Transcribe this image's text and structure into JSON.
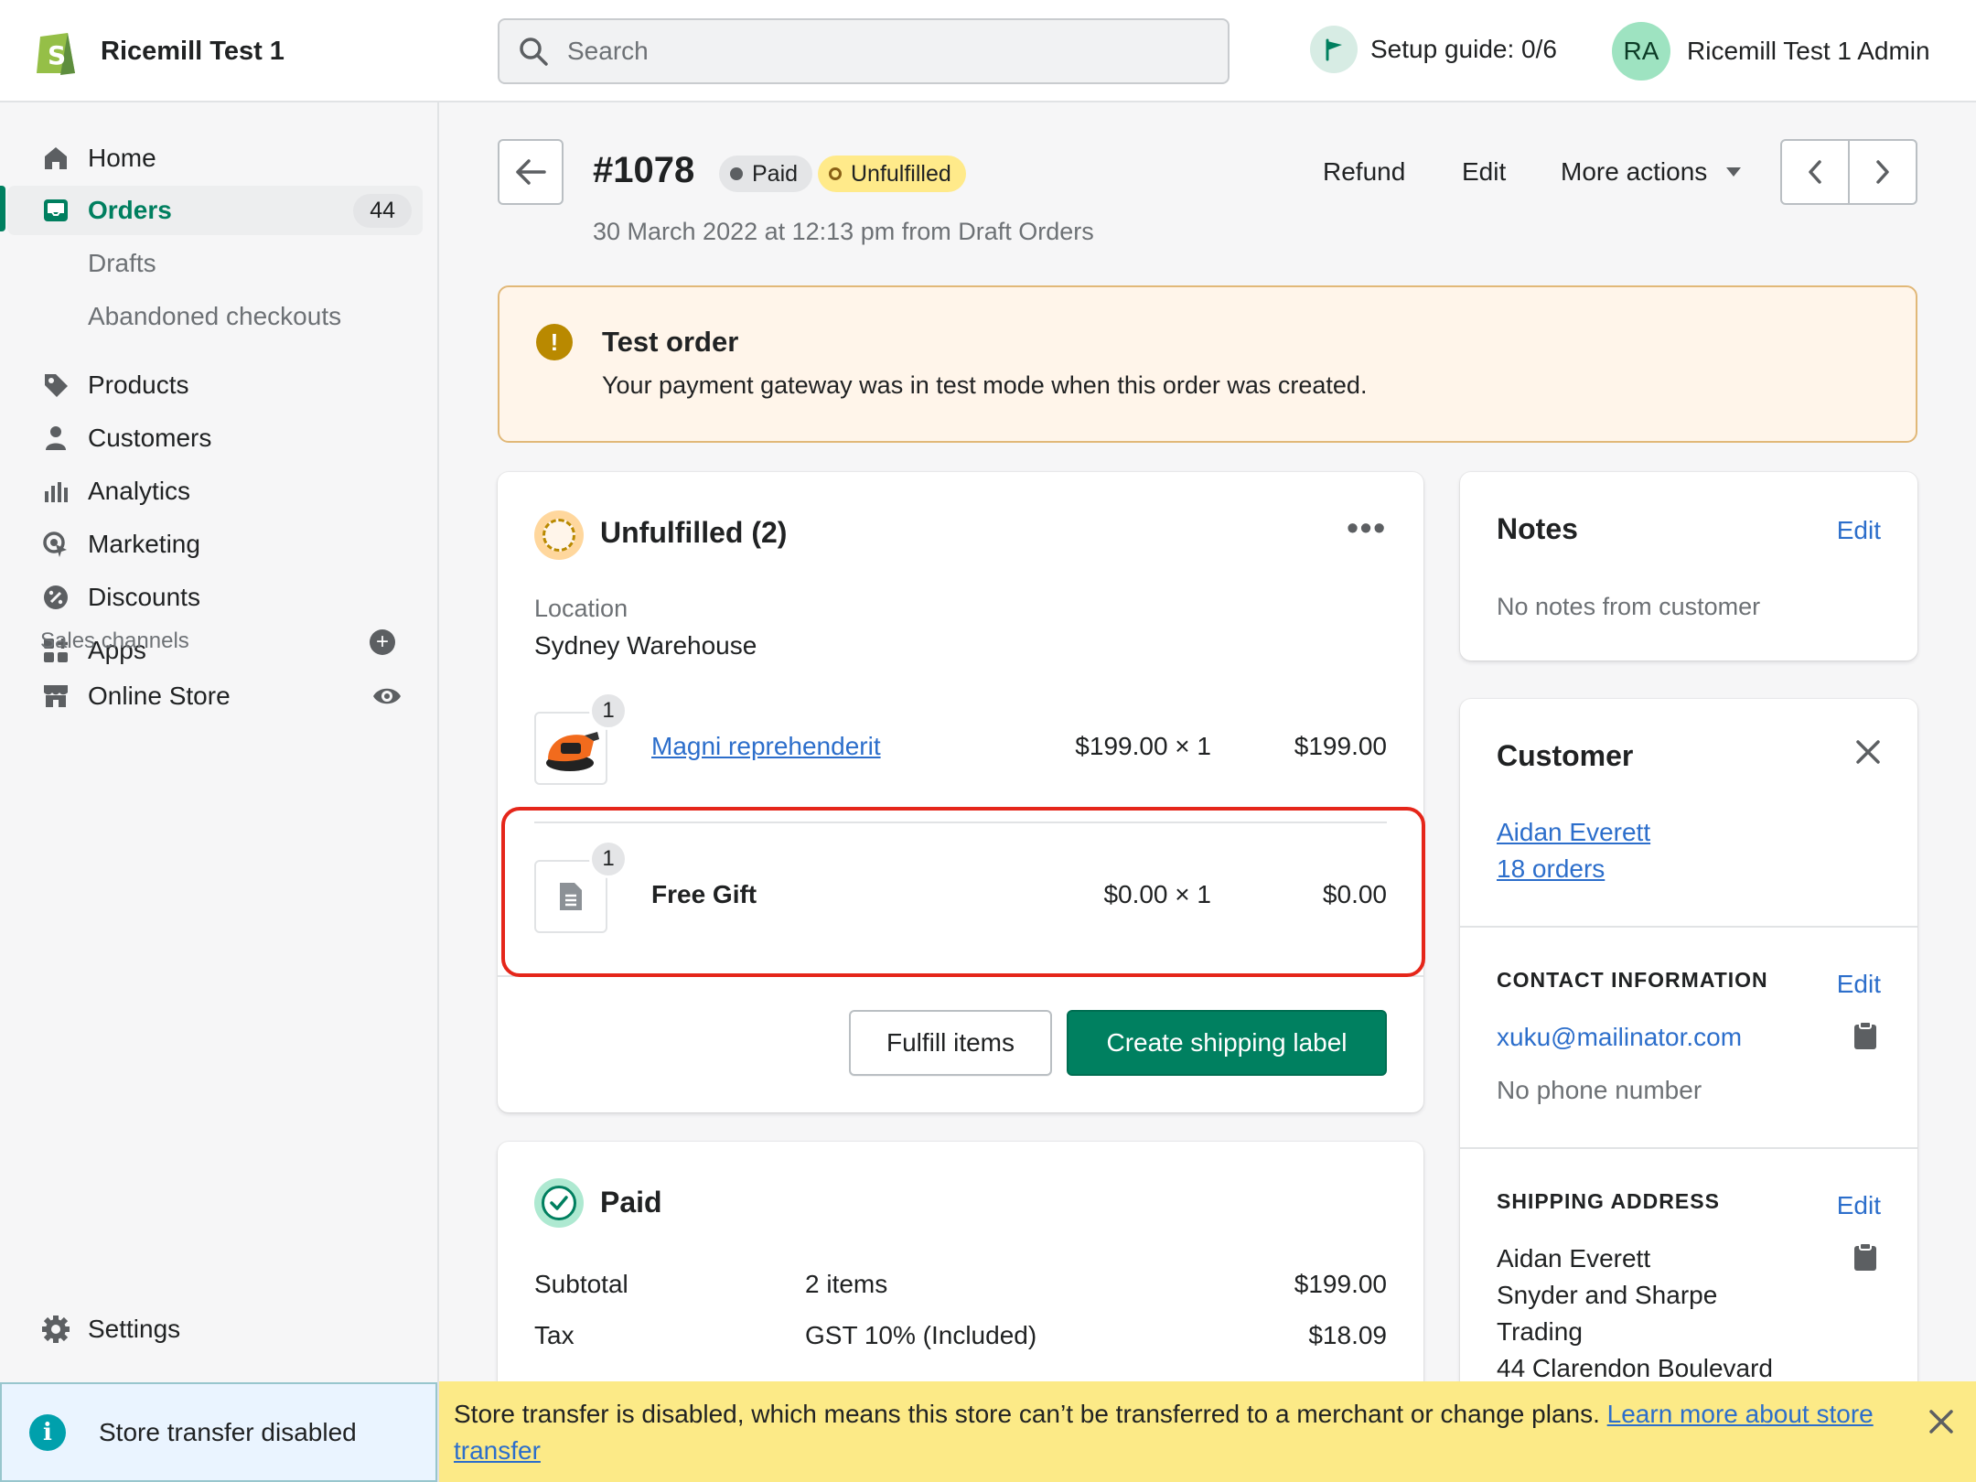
{
  "topbar": {
    "store_name": "Ricemill Test 1",
    "search_placeholder": "Search",
    "setup_guide": "Setup guide: 0/6",
    "avatar_initials": "RA",
    "account_name": "Ricemill Test 1 Admin"
  },
  "sidebar": {
    "items": [
      {
        "label": "Home",
        "icon": "home-icon"
      },
      {
        "label": "Orders",
        "icon": "orders-icon",
        "count": "44",
        "active": true
      },
      {
        "label": "Products",
        "icon": "tag-icon"
      },
      {
        "label": "Customers",
        "icon": "person-icon"
      },
      {
        "label": "Analytics",
        "icon": "bar-chart-icon"
      },
      {
        "label": "Marketing",
        "icon": "marketing-icon"
      },
      {
        "label": "Discounts",
        "icon": "discount-icon"
      },
      {
        "label": "Apps",
        "icon": "apps-icon"
      }
    ],
    "sub_items": [
      "Drafts",
      "Abandoned checkouts"
    ],
    "sales_channels_title": "Sales channels",
    "online_store": "Online Store",
    "settings": "Settings",
    "transfer_notice": "Store transfer disabled"
  },
  "order": {
    "number": "#1078",
    "payment_badge": "Paid",
    "fulfillment_badge": "Unfulfilled",
    "subline": "30 March 2022 at 12:13 pm from Draft Orders",
    "actions": {
      "refund": "Refund",
      "edit": "Edit",
      "more": "More actions"
    }
  },
  "banner": {
    "title": "Test order",
    "message": "Your payment gateway was in test mode when this order was created."
  },
  "unfulfilled": {
    "title": "Unfulfilled (2)",
    "location_label": "Location",
    "location_value": "Sydney Warehouse",
    "items": [
      {
        "qty": "1",
        "name": "Magni reprehenderit",
        "unit": "$199.00 × 1",
        "total": "$199.00"
      },
      {
        "qty": "1",
        "name": "Free Gift",
        "unit": "$0.00 × 1",
        "total": "$0.00"
      }
    ],
    "fulfill_button": "Fulfill items",
    "shipping_button": "Create shipping label"
  },
  "paid": {
    "title": "Paid",
    "rows": [
      {
        "label": "Subtotal",
        "mid": "2 items",
        "value": "$199.00"
      },
      {
        "label": "Tax",
        "mid": "GST 10% (Included)",
        "value": "$18.09"
      }
    ]
  },
  "notes": {
    "title": "Notes",
    "edit": "Edit",
    "empty": "No notes from customer"
  },
  "customer": {
    "title": "Customer",
    "name": "Aidan Everett",
    "orders": "18 orders",
    "contact_title": "CONTACT INFORMATION",
    "contact_edit": "Edit",
    "email": "xuku@mailinator.com",
    "phone": "No phone number",
    "shipping_title": "SHIPPING ADDRESS",
    "shipping_edit": "Edit",
    "address_lines": [
      "Aidan Everett",
      "Snyder and Sharpe",
      "Trading",
      "44 Clarendon Boulevard"
    ]
  },
  "transfer_bar": {
    "message": "Store transfer is disabled, which means this store can’t be transferred to a merchant or change plans.",
    "link": "Learn more about store transfer"
  },
  "colors": {
    "accent_green": "#008060",
    "link_blue": "#2c6ecb",
    "highlight_red": "#e5261a",
    "warning_bg": "#fff5ea",
    "notice_yellow": "#fcea87"
  }
}
